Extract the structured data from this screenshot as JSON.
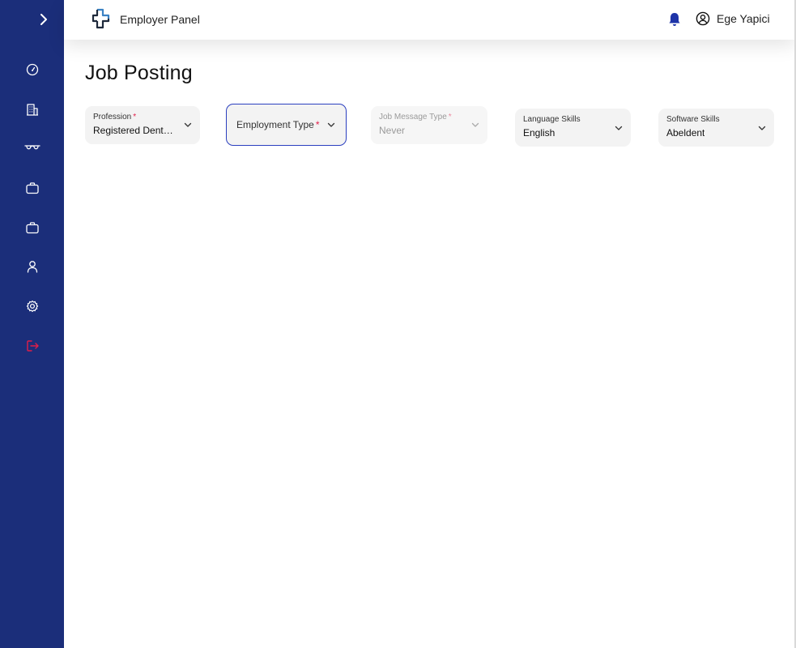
{
  "header": {
    "brand_title": "Employer Panel",
    "user_name": "Ege Yapici"
  },
  "page": {
    "title": "Job Posting"
  },
  "sidebar": {
    "items": [
      {
        "icon": "dashboard-icon"
      },
      {
        "icon": "building-icon"
      },
      {
        "icon": "glasses-icon"
      },
      {
        "icon": "briefcase-icon"
      },
      {
        "icon": "briefcase-icon"
      },
      {
        "icon": "user-icon"
      },
      {
        "icon": "gear-icon"
      },
      {
        "icon": "logout-icon"
      }
    ]
  },
  "form": {
    "profession": {
      "label": "Profession",
      "required_mark": "*",
      "value": "Registered Dental Nurse"
    },
    "employment_type": {
      "label": "Employment Type",
      "required_mark": "*",
      "value": ""
    },
    "job_message_type": {
      "label": "Job Message Type",
      "required_mark": "*",
      "value": "Never"
    },
    "language_skills": {
      "label": "Language Skills",
      "value": "English"
    },
    "software_skills": {
      "label": "Software Skills",
      "value": "Abeldent"
    }
  },
  "colors": {
    "sidebar": "#1b2e7a",
    "accent": "#1e34a8",
    "required": "#e11d48",
    "logout": "#e11d48",
    "focus_border": "#2b3fbf"
  }
}
